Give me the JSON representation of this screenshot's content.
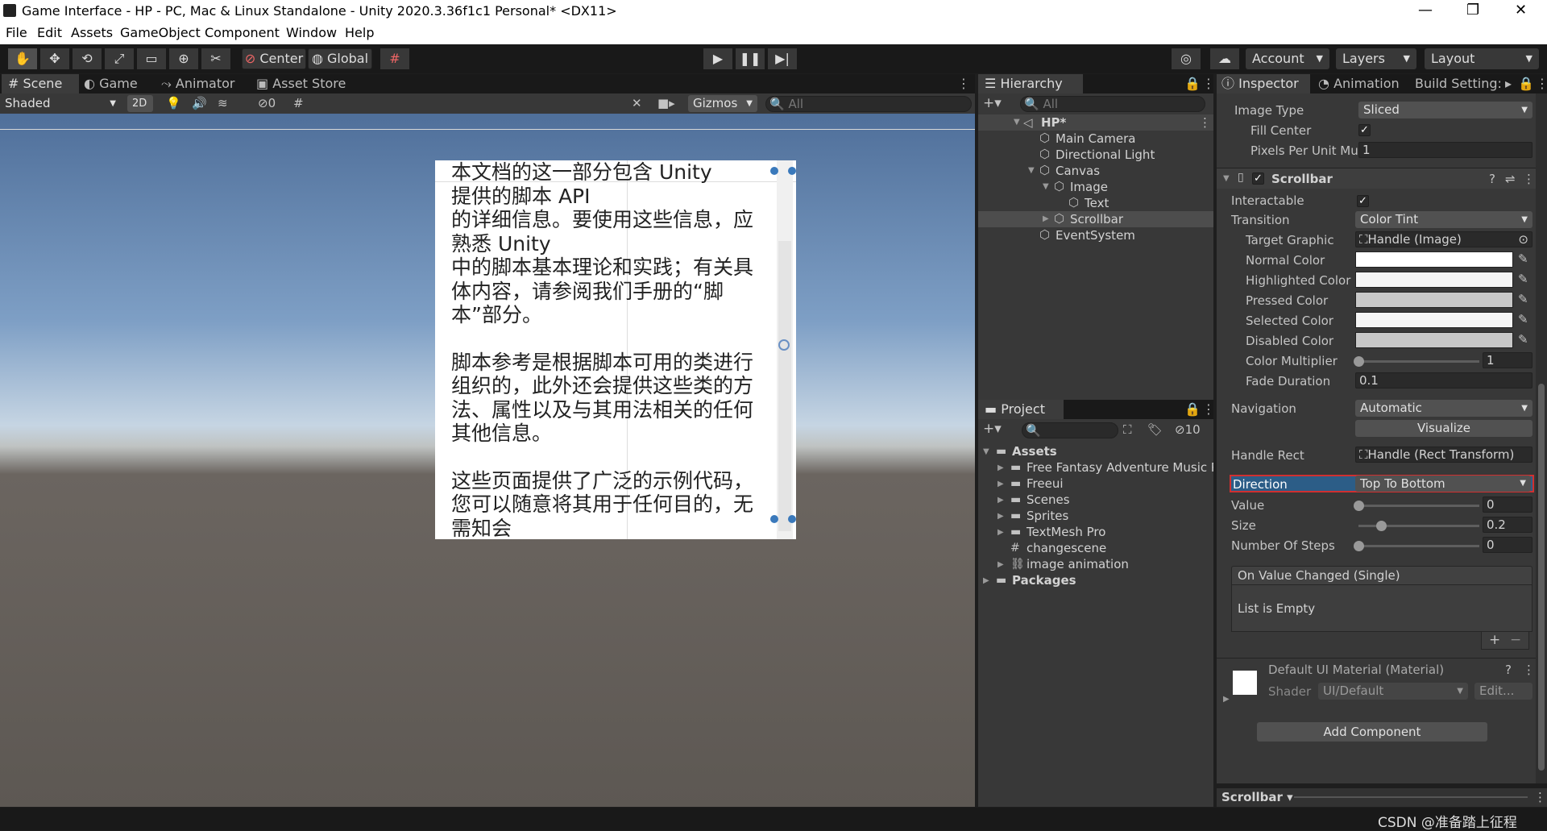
{
  "window": {
    "title": "Game Interface - HP - PC, Mac & Linux Standalone - Unity 2020.3.36f1c1 Personal* <DX11>",
    "minimize": "—",
    "restore": "❐",
    "close": "✕"
  },
  "menu": [
    "File",
    "Edit",
    "Assets",
    "GameObject",
    "Component",
    "Window",
    "Help"
  ],
  "toolbar": {
    "pivot_label": "Center",
    "space_label": "Global",
    "account_label": "Account",
    "layers_label": "Layers",
    "layout_label": "Layout"
  },
  "scene_tabs": {
    "scene": "Scene",
    "game": "Game",
    "animator": "Animator",
    "asset_store": "Asset Store"
  },
  "scene_toolbar": {
    "shading": "Shaded",
    "mode_2d": "2D",
    "hidden_count": "0",
    "gizmos": "Gizmos",
    "search_placeholder": "All"
  },
  "scene_text": {
    "paragraph1": "本文档的这一部分包含 Unity\n提供的脚本 API\n的详细信息。要使用这些信息，应熟悉 Unity\n中的脚本基本理论和实践；有关具体内容，请参阅我们手册的“脚本”部分。",
    "paragraph2": "脚本参考是根据脚本可用的类进行组织的，此外还会提供这些类的方法、属性以及与其用法相关的任何其他信息。",
    "paragraph3": "这些页面提供了广泛的示例代码，您可以随意将其用于任何目的，无需知会"
  },
  "hierarchy": {
    "tab": "Hierarchy",
    "search_placeholder": "All",
    "items": [
      {
        "label": "HP*",
        "depth": 0
      },
      {
        "label": "Main Camera",
        "depth": 1
      },
      {
        "label": "Directional Light",
        "depth": 1
      },
      {
        "label": "Canvas",
        "depth": 1
      },
      {
        "label": "Image",
        "depth": 2
      },
      {
        "label": "Text",
        "depth": 3
      },
      {
        "label": "Scrollbar",
        "depth": 2
      },
      {
        "label": "EventSystem",
        "depth": 1
      }
    ]
  },
  "project": {
    "tab": "Project",
    "hidden_count": "10",
    "items": [
      {
        "label": "Assets",
        "depth": 0,
        "kind": "folder"
      },
      {
        "label": "Free Fantasy Adventure Music P",
        "depth": 1,
        "kind": "folder"
      },
      {
        "label": "Freeui",
        "depth": 1,
        "kind": "folder"
      },
      {
        "label": "Scenes",
        "depth": 1,
        "kind": "folder"
      },
      {
        "label": "Sprites",
        "depth": 1,
        "kind": "folder"
      },
      {
        "label": "TextMesh Pro",
        "depth": 1,
        "kind": "folder"
      },
      {
        "label": "changescene",
        "depth": 1,
        "kind": "script"
      },
      {
        "label": "image animation",
        "depth": 1,
        "kind": "anim"
      },
      {
        "label": "Packages",
        "depth": 0,
        "kind": "folder"
      }
    ]
  },
  "inspector": {
    "tabs": {
      "inspector": "Inspector",
      "animation": "Animation",
      "build": "Build Setting:"
    },
    "image": {
      "image_type_label": "Image Type",
      "image_type_value": "Sliced",
      "fill_center_label": "Fill Center",
      "pixels_label": "Pixels Per Unit Mu",
      "pixels_value": "1"
    },
    "scrollbar": {
      "header": "Scrollbar",
      "interactable_label": "Interactable",
      "transition_label": "Transition",
      "transition_value": "Color Tint",
      "target_graphic_label": "Target Graphic",
      "target_graphic_value": "Handle (Image)",
      "normal_color_label": "Normal Color",
      "highlighted_color_label": "Highlighted Color",
      "pressed_color_label": "Pressed Color",
      "selected_color_label": "Selected Color",
      "disabled_color_label": "Disabled Color",
      "color_multiplier_label": "Color Multiplier",
      "color_multiplier_value": "1",
      "fade_duration_label": "Fade Duration",
      "fade_duration_value": "0.1",
      "navigation_label": "Navigation",
      "navigation_value": "Automatic",
      "visualize_label": "Visualize",
      "handle_rect_label": "Handle Rect",
      "handle_rect_value": "Handle (Rect Transform)",
      "direction_label": "Direction",
      "direction_value": "Top To Bottom",
      "value_label": "Value",
      "value_value": "0",
      "size_label": "Size",
      "size_value": "0.2",
      "steps_label": "Number Of Steps",
      "steps_value": "0",
      "event_header": "On Value Changed (Single)",
      "event_empty": "List is Empty"
    },
    "material": {
      "title": "Default UI Material (Material)",
      "shader_label": "Shader",
      "shader_value": "UI/Default",
      "edit_label": "Edit..."
    },
    "add_component": "Add Component",
    "footer_label": "Scrollbar"
  },
  "colors": {
    "accent": "#3a79bb",
    "highlight_border": "#d03030",
    "selected_row": "#4d4d4d"
  },
  "watermark": "CSDN @准备踏上征程"
}
